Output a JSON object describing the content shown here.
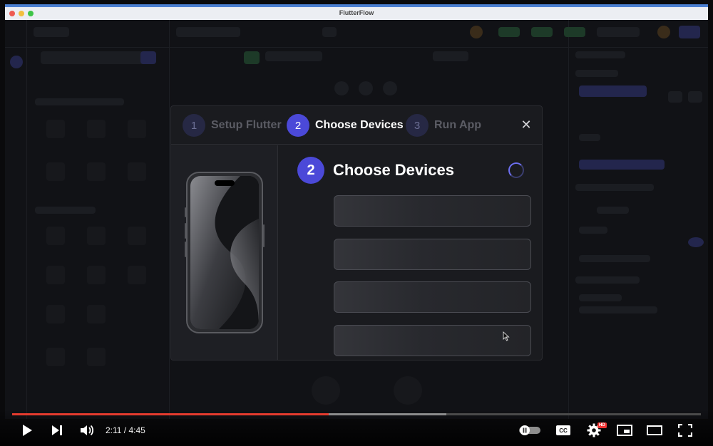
{
  "window": {
    "title": "FlutterFlow"
  },
  "modal": {
    "steps": [
      {
        "number": "1",
        "label": "Setup Flutter",
        "active": false
      },
      {
        "number": "2",
        "label": "Choose Devices",
        "active": true
      },
      {
        "number": "3",
        "label": "Run App",
        "active": false
      }
    ],
    "close_label": "✕",
    "heading": {
      "number": "2",
      "title": "Choose Devices"
    },
    "device_slots": [
      "",
      "",
      "",
      ""
    ]
  },
  "player": {
    "time_display": "2:11 / 4:45",
    "played_fraction": 0.46,
    "buffered_fraction": 0.63,
    "hd_badge": "HD",
    "cc_label": "CC"
  },
  "colors": {
    "accent": "#4b49d8",
    "progress": "#e53b2e"
  }
}
